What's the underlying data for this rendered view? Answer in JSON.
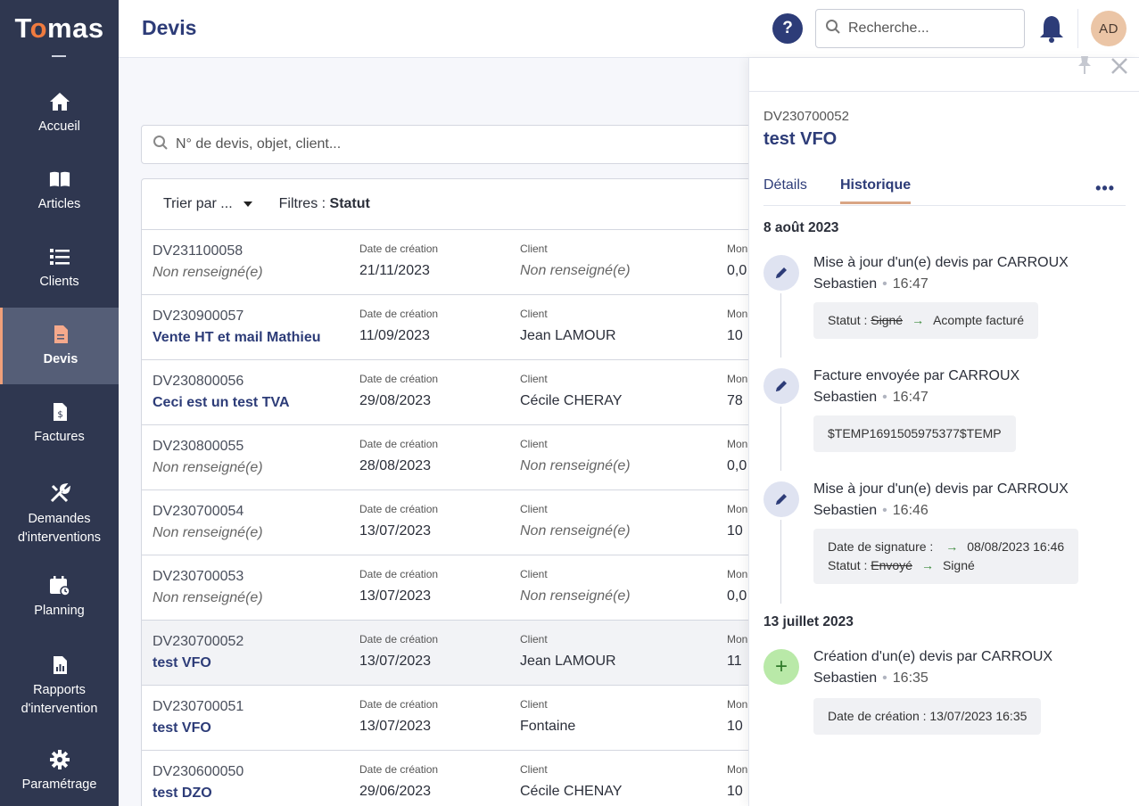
{
  "app": {
    "logo_pre": "T",
    "logo_o": "o",
    "logo_post": "mas"
  },
  "sidebar": {
    "items": [
      {
        "label": "Accueil",
        "icon": "home-icon"
      },
      {
        "label": "Articles",
        "icon": "book-icon"
      },
      {
        "label": "Clients",
        "icon": "list-icon"
      },
      {
        "label": "Devis",
        "icon": "document-icon",
        "active": true
      },
      {
        "label": "Factures",
        "icon": "invoice-icon"
      },
      {
        "label": "Demandes d'interventions",
        "icon": "tools-icon"
      },
      {
        "label": "Planning",
        "icon": "calendar-icon"
      },
      {
        "label": "Rapports d'intervention",
        "icon": "report-icon"
      },
      {
        "label": "Paramétrage",
        "icon": "gear-icon"
      }
    ]
  },
  "header": {
    "title": "Devis",
    "help": "?",
    "search_placeholder": "Recherche...",
    "avatar": "AD"
  },
  "list": {
    "search_placeholder": "N° de devis, objet, client...",
    "sort_label": "Trier par ...",
    "filters_label": "Filtres : ",
    "filters_value": "Statut",
    "col_date": "Date de création",
    "col_client": "Client",
    "col_montant": "Mon",
    "rows": [
      {
        "ref": "DV231100058",
        "object": "Non renseigné(e)",
        "date": "21/11/2023",
        "client": "Non renseigné(e)",
        "montant": "0,0"
      },
      {
        "ref": "DV230900057",
        "object": "Vente HT et mail Mathieu",
        "date": "11/09/2023",
        "client": "Jean LAMOUR",
        "montant": "10"
      },
      {
        "ref": "DV230800056",
        "object": "Ceci est un test TVA",
        "date": "29/08/2023",
        "client": "Cécile CHERAY",
        "montant": "78"
      },
      {
        "ref": "DV230800055",
        "object": "Non renseigné(e)",
        "date": "28/08/2023",
        "client": "Non renseigné(e)",
        "montant": "0,0"
      },
      {
        "ref": "DV230700054",
        "object": "Non renseigné(e)",
        "date": "13/07/2023",
        "client": "Non renseigné(e)",
        "montant": "10"
      },
      {
        "ref": "DV230700053",
        "object": "Non renseigné(e)",
        "date": "13/07/2023",
        "client": "Non renseigné(e)",
        "montant": "0,0"
      },
      {
        "ref": "DV230700052",
        "object": "test VFO",
        "date": "13/07/2023",
        "client": "Jean LAMOUR",
        "montant": "11"
      },
      {
        "ref": "DV230700051",
        "object": "test VFO",
        "date": "13/07/2023",
        "client": "Fontaine",
        "montant": "10"
      },
      {
        "ref": "DV230600050",
        "object": "test DZO",
        "date": "29/06/2023",
        "client": "Cécile CHENAY",
        "montant": "10"
      }
    ]
  },
  "panel": {
    "ref": "DV230700052",
    "title": "test VFO",
    "tabs": [
      "Détails",
      "Historique"
    ],
    "more": "•••",
    "groups": [
      {
        "date": "8 août 2023",
        "events": [
          {
            "title": "Mise à jour d'un(e) devis par CARROUX Sebastien",
            "time": "16:47",
            "lines": [
              {
                "label": "Statut : ",
                "old": "Signé",
                "new": "Acompte facturé"
              }
            ]
          },
          {
            "title": "Facture envoyée par CARROUX Sebastien",
            "time": "16:47",
            "text": "$TEMP1691505975377$TEMP"
          },
          {
            "title": "Mise à jour d'un(e) devis par CARROUX Sebastien",
            "time": "16:46",
            "lines": [
              {
                "label": "Date de signature : ",
                "old": "",
                "new": "08/08/2023 16:46"
              },
              {
                "label": "Statut : ",
                "old": "Envoyé",
                "new": "Signé"
              }
            ]
          }
        ]
      },
      {
        "date": "13 juillet 2023",
        "events": [
          {
            "title": "Création d'un(e) devis par CARROUX Sebastien",
            "time": "16:35",
            "text": "Date de création : 13/07/2023 16:35"
          }
        ]
      }
    ]
  }
}
